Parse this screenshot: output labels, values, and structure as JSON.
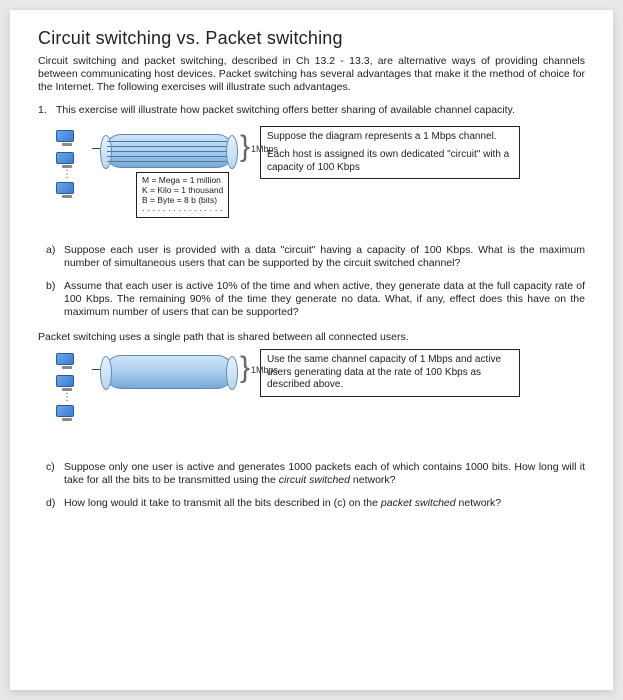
{
  "title": "Circuit switching vs. Packet switching",
  "intro": "Circuit switching and packet switching, described in Ch 13.2 - 13.3, are alternative ways of providing channels between communicating host devices. Packet switching has several advantages that make it the method of choice for the Internet. The following exercises will illustrate such advantages.",
  "exercise1": {
    "num": "1.",
    "text": "This exercise will illustrate how packet switching offers better sharing of available channel capacity."
  },
  "diagram1": {
    "rate_label": "1Mbps",
    "legend_m": "M = Mega = 1 million",
    "legend_k": "K = Kilo = 1 thousand",
    "legend_b": "B = Byte = 8 b (bits)",
    "legend_dots": "· · · ·  ·  · · ·  · · · · · · · ·",
    "box_line1": "Suppose the diagram represents a 1 Mbps channel.",
    "box_line2": "Each host is assigned its own dedicated \"circuit\" with a capacity of 100 Kbps"
  },
  "qa": {
    "label": "a)",
    "text": "Suppose each user is provided with a data \"circuit\" having a capacity of 100 Kbps. What is the maximum number of simultaneous users that can be supported by the circuit switched channel?"
  },
  "qb": {
    "label": "b)",
    "text": "Assume that each user is active 10% of the time and when active, they generate data at the full capacity rate of 100 Kbps. The remaining 90% of the time they generate no data. What, if any, effect does this have on the maximum number of users that can be supported?"
  },
  "mid_text": "Packet switching uses a single path that is shared between all connected users.",
  "diagram2": {
    "rate_label": "1Mbps",
    "box_text": "Use the same channel capacity of 1 Mbps and active users generating data at the rate of 100 Kbps as described above."
  },
  "qc": {
    "label": "c)",
    "text_pre": "Suppose only one user is active and generates 1000 packets each of which contains 1000 bits. How long will it take for all the bits to be transmitted using the ",
    "text_em": "circuit switched",
    "text_post": " network?"
  },
  "qd": {
    "label": "d)",
    "text_pre": "How long would it take to transmit all the bits described in (c) on the ",
    "text_em": "packet switched",
    "text_post": " network?"
  }
}
